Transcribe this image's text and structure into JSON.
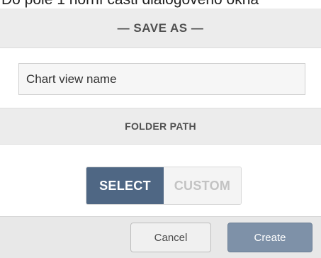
{
  "caption": "Do pole 1 horní části dialogového okna",
  "dialog": {
    "title": "— SAVE AS —",
    "name_field": {
      "value": "Chart view name",
      "placeholder": ""
    },
    "folder_path": {
      "header": "FOLDER PATH",
      "options": [
        "SELECT",
        "CUSTOM"
      ],
      "selected": "SELECT"
    },
    "buttons": {
      "cancel": "Cancel",
      "create": "Create"
    }
  },
  "colors": {
    "accent": "#4f6784",
    "primary_button": "#7e91a8",
    "header_bg": "#ececec"
  }
}
